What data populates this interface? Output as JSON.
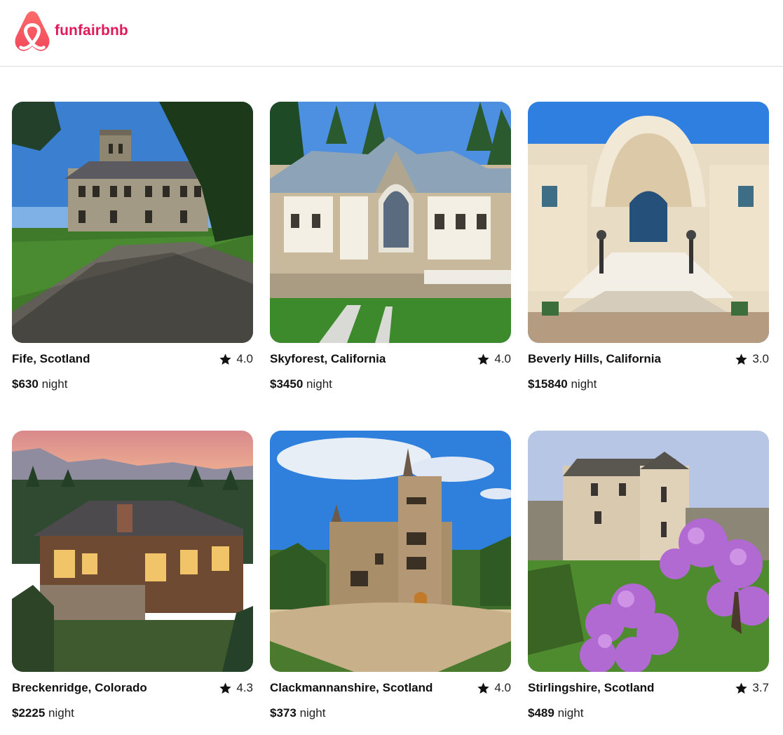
{
  "brand": {
    "name": "funfairbnb",
    "color": "#e0195a",
    "logo_icon": "airbnb-style-logo-icon"
  },
  "listings": [
    {
      "location": "Fife, Scotland",
      "rating": "4.0",
      "price": "$630",
      "unit": "night",
      "star_icon": "star-icon"
    },
    {
      "location": "Skyforest, California",
      "rating": "4.0",
      "price": "$3450",
      "unit": "night",
      "star_icon": "star-icon"
    },
    {
      "location": "Beverly Hills, California",
      "rating": "3.0",
      "price": "$15840",
      "unit": "night",
      "star_icon": "star-icon"
    },
    {
      "location": "Breckenridge, Colorado",
      "rating": "4.3",
      "price": "$2225",
      "unit": "night",
      "star_icon": "star-icon"
    },
    {
      "location": "Clackmannanshire, Scotland",
      "rating": "4.0",
      "price": "$373",
      "unit": "night",
      "star_icon": "star-icon"
    },
    {
      "location": "Stirlingshire, Scotland",
      "rating": "3.7",
      "price": "$489",
      "unit": "night",
      "star_icon": "star-icon"
    }
  ]
}
